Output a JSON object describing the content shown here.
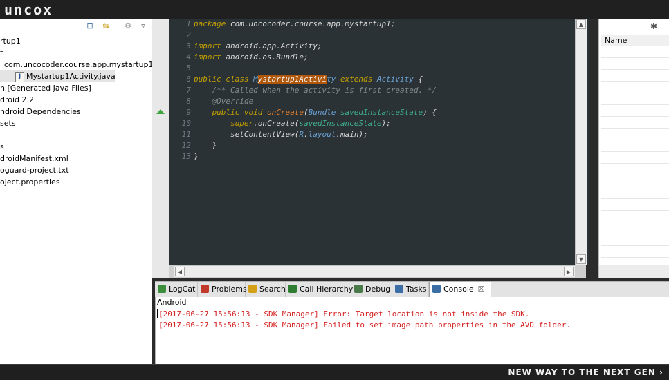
{
  "brand": "uncox",
  "tagline": "NEW WAY TO THE NEXT GEN ›",
  "explorer": {
    "items": [
      {
        "label": "rtup1"
      },
      {
        "label": "t"
      },
      {
        "label": "com.uncocoder.course.app.mystartup1"
      },
      {
        "label": "Mystartup1Activity.java",
        "selected": true,
        "icon": "J"
      },
      {
        "label": "n [Generated Java Files]"
      },
      {
        "label": "droid 2.2"
      },
      {
        "label": "ndroid Dependencies"
      },
      {
        "label": "sets"
      },
      {
        "label": ""
      },
      {
        "label": "s"
      },
      {
        "label": "droidManifest.xml"
      },
      {
        "label": "oguard-project.txt"
      },
      {
        "label": "oject.properties"
      }
    ]
  },
  "editor": {
    "line_numbers": [
      "1",
      "2",
      "3",
      "4",
      "5",
      "6",
      "7",
      "8",
      "9",
      "10",
      "11",
      "12",
      "13"
    ],
    "lines": [
      [
        {
          "t": "package ",
          "c": "kw"
        },
        {
          "t": "com.uncocoder.course.app.mystartup1;",
          "c": "tx"
        }
      ],
      [],
      [
        {
          "t": "import ",
          "c": "kw"
        },
        {
          "t": "android.app.Activity;",
          "c": "tx"
        }
      ],
      [
        {
          "t": "import ",
          "c": "kw"
        },
        {
          "t": "android.os.Bundle;",
          "c": "tx"
        }
      ],
      [],
      [
        {
          "t": "public class ",
          "c": "kw"
        },
        {
          "t": "M",
          "c": "ty"
        },
        {
          "t": "ystartup1Activi",
          "c": "hl"
        },
        {
          "t": "ty ",
          "c": "ty"
        },
        {
          "t": "extends ",
          "c": "kw"
        },
        {
          "t": "Activity ",
          "c": "ty"
        },
        {
          "t": "{",
          "c": "tx"
        }
      ],
      [
        {
          "t": "    /** Called when the activity is first created. */",
          "c": "cm"
        }
      ],
      [
        {
          "t": "    @Override",
          "c": "cm"
        }
      ],
      [
        {
          "t": "    public void ",
          "c": "kw"
        },
        {
          "t": "onCreate",
          "c": "fn"
        },
        {
          "t": "(",
          "c": "tx"
        },
        {
          "t": "Bundle ",
          "c": "ty"
        },
        {
          "t": "savedInstanceState",
          "c": "pr"
        },
        {
          "t": ") {",
          "c": "tx"
        }
      ],
      [
        {
          "t": "        super",
          "c": "kw"
        },
        {
          "t": ".onCreate(",
          "c": "tx"
        },
        {
          "t": "savedInstanceState",
          "c": "pr"
        },
        {
          "t": ");",
          "c": "tx"
        }
      ],
      [
        {
          "t": "        setContentView(",
          "c": "tx"
        },
        {
          "t": "R",
          "c": "ty"
        },
        {
          "t": ".",
          "c": "tx"
        },
        {
          "t": "layout",
          "c": "ty"
        },
        {
          "t": ".main);",
          "c": "tx"
        }
      ],
      [
        {
          "t": "    }",
          "c": "tx"
        }
      ],
      [
        {
          "t": "}",
          "c": "tx"
        }
      ]
    ]
  },
  "right_panel": {
    "column_header": "Name"
  },
  "bottom_tabs": [
    {
      "label": "LogCat",
      "icon_color": "#3c8d3c"
    },
    {
      "label": "Problems",
      "icon_color": "#c0392b"
    },
    {
      "label": "Search",
      "icon_color": "#d4a017"
    },
    {
      "label": "Call Hierarchy",
      "icon_color": "#2e7d32"
    },
    {
      "label": "Debug",
      "icon_color": "#4a7a4a"
    },
    {
      "label": "Tasks",
      "icon_color": "#3b6ea5"
    },
    {
      "label": "Console",
      "icon_color": "#3b6ea5",
      "active": true,
      "close": "☒"
    }
  ],
  "console": {
    "title": "Android",
    "lines": [
      "[2017-06-27 15:56:13 - SDK Manager] Error: Target location is not inside the SDK.",
      "[2017-06-27 15:56:13 - SDK Manager] Failed to set image path properties in the AVD folder."
    ]
  }
}
